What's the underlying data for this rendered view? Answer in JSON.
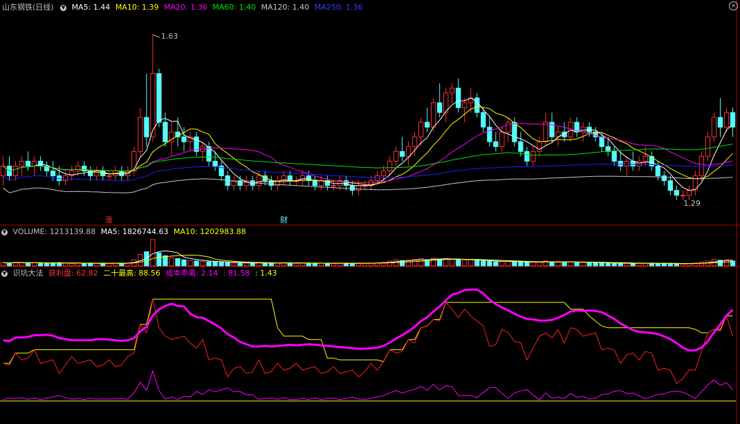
{
  "colors": {
    "up": "#ff3232",
    "down": "#54fcfc",
    "ma5": "#ffffff",
    "ma10": "#ffff00",
    "ma20": "#ff00ff",
    "ma60": "#00e600",
    "ma120": "#c8c8c8",
    "ma250": "#1e1eff",
    "panel_border": "#b00000",
    "grid": "#5a0000"
  },
  "header_price": {
    "title": "山东钢铁(日线)",
    "ma5": "MA5: 1.44",
    "ma10": "MA10: 1.39",
    "ma20": "MA20: 1.36",
    "ma60": "MA60: 1.40",
    "ma120": "MA120: 1.40",
    "ma250": "MA250: 1.36"
  },
  "header_volume": {
    "volume": "VOLUME: 1213139.88",
    "ma5": "MA5: 1826744.63",
    "ma10": "MA10: 1202983.88"
  },
  "header_indicator": {
    "name": "识坑大法",
    "profit": "获利盘: 62.82",
    "high20": "二十最高: 88.56",
    "cost": "成本乖离: 2.14",
    "v1": ": 81.58",
    "v2": ": 1.43"
  },
  "icons": {
    "dropdown": "chevron-down-icon",
    "close": "close-icon"
  },
  "markers": {
    "zhang": "涨",
    "cai": "财"
  },
  "chart_data": {
    "type": "candlestick",
    "title": "山东钢铁(日线)",
    "price_annotations": {
      "high": "1.63",
      "low": "1.29"
    },
    "price_range": [
      1.25,
      1.67
    ],
    "candles": [
      [
        1.34,
        1.38,
        1.32,
        1.36
      ],
      [
        1.36,
        1.38,
        1.33,
        1.34
      ],
      [
        1.34,
        1.37,
        1.33,
        1.36
      ],
      [
        1.36,
        1.38,
        1.34,
        1.37
      ],
      [
        1.37,
        1.39,
        1.35,
        1.36
      ],
      [
        1.36,
        1.38,
        1.34,
        1.37
      ],
      [
        1.37,
        1.38,
        1.35,
        1.36
      ],
      [
        1.36,
        1.37,
        1.34,
        1.35
      ],
      [
        1.35,
        1.37,
        1.33,
        1.34
      ],
      [
        1.34,
        1.36,
        1.32,
        1.33
      ],
      [
        1.33,
        1.35,
        1.32,
        1.34
      ],
      [
        1.34,
        1.36,
        1.33,
        1.35
      ],
      [
        1.35,
        1.37,
        1.34,
        1.36
      ],
      [
        1.36,
        1.37,
        1.34,
        1.35
      ],
      [
        1.35,
        1.36,
        1.33,
        1.34
      ],
      [
        1.34,
        1.36,
        1.33,
        1.35
      ],
      [
        1.35,
        1.36,
        1.33,
        1.34
      ],
      [
        1.34,
        1.35,
        1.33,
        1.34
      ],
      [
        1.34,
        1.36,
        1.33,
        1.35
      ],
      [
        1.35,
        1.36,
        1.33,
        1.34
      ],
      [
        1.34,
        1.36,
        1.33,
        1.35
      ],
      [
        1.35,
        1.4,
        1.34,
        1.39
      ],
      [
        1.39,
        1.48,
        1.38,
        1.46
      ],
      [
        1.46,
        1.55,
        1.4,
        1.42
      ],
      [
        1.42,
        1.63,
        1.41,
        1.55
      ],
      [
        1.55,
        1.56,
        1.44,
        1.45
      ],
      [
        1.45,
        1.47,
        1.4,
        1.41
      ],
      [
        1.41,
        1.45,
        1.38,
        1.43
      ],
      [
        1.43,
        1.46,
        1.4,
        1.42
      ],
      [
        1.42,
        1.44,
        1.39,
        1.41
      ],
      [
        1.41,
        1.43,
        1.39,
        1.42
      ],
      [
        1.42,
        1.43,
        1.38,
        1.39
      ],
      [
        1.39,
        1.41,
        1.37,
        1.4
      ],
      [
        1.4,
        1.41,
        1.36,
        1.37
      ],
      [
        1.37,
        1.39,
        1.35,
        1.36
      ],
      [
        1.36,
        1.37,
        1.33,
        1.34
      ],
      [
        1.34,
        1.35,
        1.31,
        1.32
      ],
      [
        1.32,
        1.34,
        1.31,
        1.33
      ],
      [
        1.33,
        1.34,
        1.31,
        1.32
      ],
      [
        1.32,
        1.34,
        1.31,
        1.33
      ],
      [
        1.33,
        1.34,
        1.31,
        1.32
      ],
      [
        1.32,
        1.35,
        1.31,
        1.34
      ],
      [
        1.34,
        1.35,
        1.32,
        1.33
      ],
      [
        1.33,
        1.34,
        1.31,
        1.32
      ],
      [
        1.32,
        1.34,
        1.31,
        1.33
      ],
      [
        1.33,
        1.35,
        1.32,
        1.34
      ],
      [
        1.34,
        1.35,
        1.32,
        1.33
      ],
      [
        1.33,
        1.34,
        1.32,
        1.33
      ],
      [
        1.33,
        1.35,
        1.32,
        1.34
      ],
      [
        1.34,
        1.35,
        1.32,
        1.33
      ],
      [
        1.33,
        1.34,
        1.31,
        1.32
      ],
      [
        1.32,
        1.34,
        1.31,
        1.33
      ],
      [
        1.33,
        1.34,
        1.31,
        1.32
      ],
      [
        1.32,
        1.33,
        1.31,
        1.32
      ],
      [
        1.32,
        1.34,
        1.31,
        1.33
      ],
      [
        1.33,
        1.34,
        1.31,
        1.32
      ],
      [
        1.32,
        1.33,
        1.3,
        1.31
      ],
      [
        1.31,
        1.33,
        1.3,
        1.32
      ],
      [
        1.32,
        1.33,
        1.31,
        1.32
      ],
      [
        1.32,
        1.34,
        1.31,
        1.33
      ],
      [
        1.33,
        1.35,
        1.32,
        1.34
      ],
      [
        1.34,
        1.36,
        1.33,
        1.35
      ],
      [
        1.35,
        1.38,
        1.34,
        1.37
      ],
      [
        1.37,
        1.4,
        1.36,
        1.39
      ],
      [
        1.39,
        1.42,
        1.37,
        1.38
      ],
      [
        1.38,
        1.41,
        1.36,
        1.4
      ],
      [
        1.4,
        1.43,
        1.38,
        1.42
      ],
      [
        1.42,
        1.46,
        1.4,
        1.45
      ],
      [
        1.45,
        1.48,
        1.43,
        1.44
      ],
      [
        1.44,
        1.5,
        1.43,
        1.49
      ],
      [
        1.49,
        1.53,
        1.46,
        1.47
      ],
      [
        1.47,
        1.52,
        1.45,
        1.51
      ],
      [
        1.51,
        1.53,
        1.49,
        1.52
      ],
      [
        1.52,
        1.54,
        1.47,
        1.48
      ],
      [
        1.48,
        1.5,
        1.45,
        1.49
      ],
      [
        1.49,
        1.52,
        1.47,
        1.5
      ],
      [
        1.5,
        1.51,
        1.46,
        1.47
      ],
      [
        1.47,
        1.48,
        1.43,
        1.44
      ],
      [
        1.44,
        1.46,
        1.4,
        1.41
      ],
      [
        1.41,
        1.43,
        1.39,
        1.4
      ],
      [
        1.4,
        1.44,
        1.39,
        1.43
      ],
      [
        1.43,
        1.46,
        1.41,
        1.45
      ],
      [
        1.45,
        1.46,
        1.4,
        1.41
      ],
      [
        1.41,
        1.43,
        1.38,
        1.39
      ],
      [
        1.39,
        1.4,
        1.36,
        1.37
      ],
      [
        1.37,
        1.4,
        1.36,
        1.39
      ],
      [
        1.39,
        1.42,
        1.38,
        1.41
      ],
      [
        1.41,
        1.47,
        1.4,
        1.45
      ],
      [
        1.45,
        1.47,
        1.41,
        1.42
      ],
      [
        1.42,
        1.44,
        1.4,
        1.43
      ],
      [
        1.43,
        1.45,
        1.41,
        1.42
      ],
      [
        1.42,
        1.46,
        1.41,
        1.45
      ],
      [
        1.45,
        1.46,
        1.42,
        1.43
      ],
      [
        1.43,
        1.45,
        1.41,
        1.44
      ],
      [
        1.44,
        1.45,
        1.42,
        1.43
      ],
      [
        1.43,
        1.44,
        1.41,
        1.42
      ],
      [
        1.42,
        1.43,
        1.39,
        1.4
      ],
      [
        1.4,
        1.42,
        1.38,
        1.39
      ],
      [
        1.39,
        1.4,
        1.36,
        1.37
      ],
      [
        1.37,
        1.39,
        1.35,
        1.36
      ],
      [
        1.36,
        1.38,
        1.34,
        1.37
      ],
      [
        1.37,
        1.39,
        1.35,
        1.36
      ],
      [
        1.36,
        1.38,
        1.35,
        1.37
      ],
      [
        1.37,
        1.4,
        1.36,
        1.38
      ],
      [
        1.38,
        1.39,
        1.35,
        1.36
      ],
      [
        1.36,
        1.37,
        1.33,
        1.34
      ],
      [
        1.34,
        1.35,
        1.32,
        1.33
      ],
      [
        1.33,
        1.34,
        1.3,
        1.31
      ],
      [
        1.31,
        1.32,
        1.29,
        1.3
      ],
      [
        1.3,
        1.31,
        1.29,
        1.3
      ],
      [
        1.3,
        1.32,
        1.29,
        1.31
      ],
      [
        1.31,
        1.35,
        1.3,
        1.34
      ],
      [
        1.34,
        1.39,
        1.33,
        1.38
      ],
      [
        1.38,
        1.43,
        1.37,
        1.42
      ],
      [
        1.42,
        1.47,
        1.41,
        1.46
      ],
      [
        1.46,
        1.5,
        1.42,
        1.44
      ],
      [
        1.44,
        1.48,
        1.43,
        1.47
      ],
      [
        1.47,
        1.48,
        1.42,
        1.44
      ]
    ],
    "volume_range": [
      0,
      7000000
    ],
    "volume": [
      800000,
      700000,
      900000,
      800000,
      700000,
      800000,
      700000,
      600000,
      700000,
      800000,
      700000,
      600000,
      700000,
      600000,
      700000,
      600000,
      650000,
      600000,
      700000,
      650000,
      700000,
      1500000,
      2800000,
      3500000,
      6500000,
      3200000,
      2500000,
      2000000,
      1800000,
      1500000,
      1300000,
      1200000,
      1100000,
      1000000,
      1000000,
      900000,
      800000,
      700000,
      750000,
      700000,
      650000,
      800000,
      700000,
      650000,
      700000,
      800000,
      700000,
      650000,
      700000,
      650000,
      600000,
      700000,
      650000,
      600000,
      700000,
      650000,
      600000,
      700000,
      650000,
      700000,
      800000,
      900000,
      1200000,
      1500000,
      1300000,
      1400000,
      1600000,
      1800000,
      1500000,
      1900000,
      1700000,
      1800000,
      1600000,
      1500000,
      1400000,
      1500000,
      1300000,
      1200000,
      1100000,
      1000000,
      1100000,
      1200000,
      1000000,
      900000,
      850000,
      900000,
      950000,
      1200000,
      1000000,
      900000,
      950000,
      1000000,
      900000,
      850000,
      800000,
      750000,
      700000,
      700000,
      650000,
      600000,
      650000,
      600000,
      650000,
      700000,
      650000,
      600000,
      550000,
      600000,
      550000,
      500000,
      550000,
      700000,
      900000,
      1200000,
      1600000,
      1400000,
      1500000,
      1213139.88
    ]
  }
}
